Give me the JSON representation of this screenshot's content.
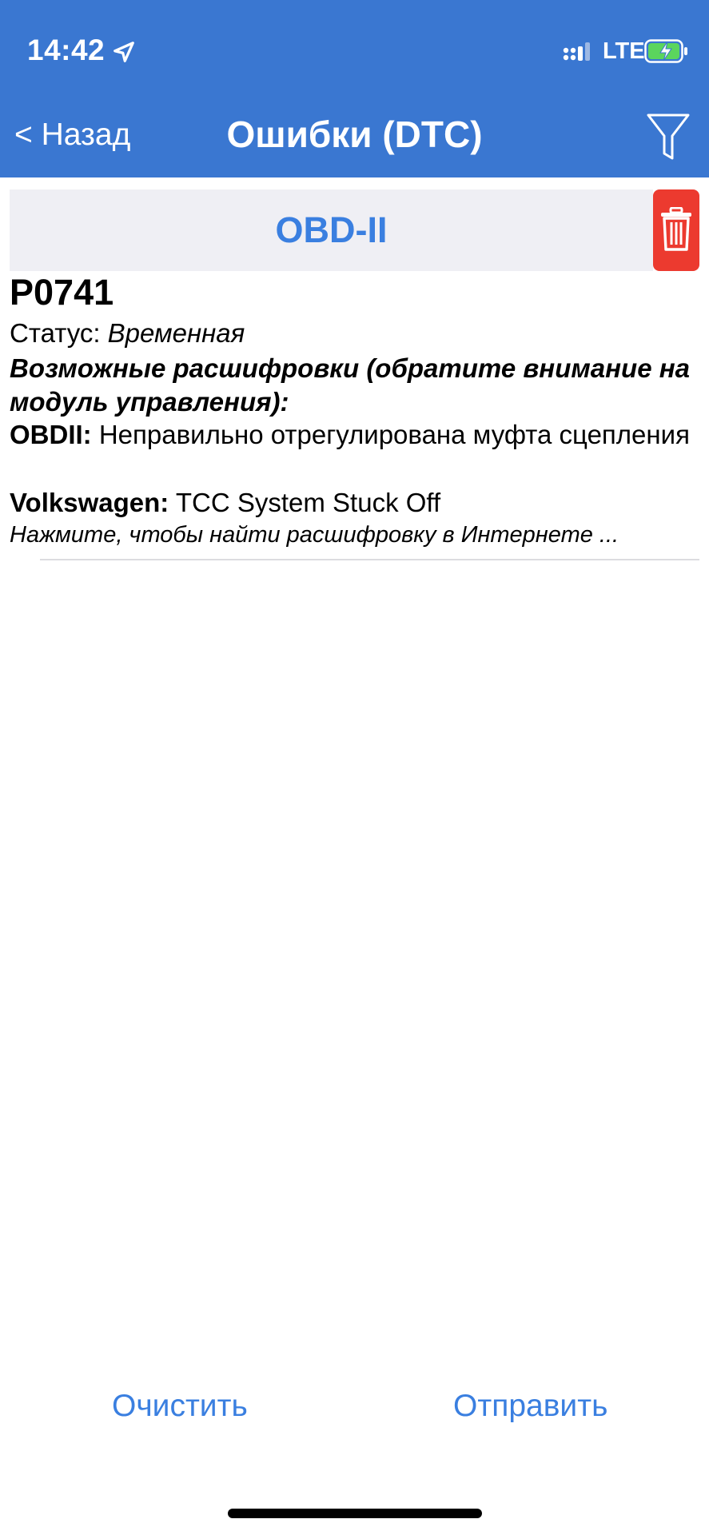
{
  "status_bar": {
    "time": "14:42",
    "network": "LTE"
  },
  "nav": {
    "back_label": "< Назад",
    "title": "Ошибки (DTC)"
  },
  "section": {
    "title": "OBD-II"
  },
  "dtc": {
    "code": "P0741",
    "status_label": "Статус: ",
    "status_value": "Временная",
    "decoding_heading": "Возможные расшифровки (обратите внимание на модуль управления):",
    "entries": [
      {
        "source": "OBDII:",
        "text": " Неправильно отрегулирована муфта сцепления"
      },
      {
        "source": "Volkswagen:",
        "text": " TCC System Stuck Off"
      }
    ],
    "hint": "Нажмите, чтобы найти расшифровку в Интернете ..."
  },
  "actions": {
    "clear_label": "Очистить",
    "send_label": "Отправить"
  },
  "colors": {
    "nav_background": "#3a77d1",
    "accent": "#3a7fe0",
    "delete": "#ec3a2f",
    "section_background": "#efeff4"
  },
  "icons": {
    "location": "location-arrow-icon",
    "signal": "signal-dots-icon",
    "battery": "battery-charging-icon",
    "filter": "filter-funnel-icon",
    "delete": "trash-icon"
  }
}
